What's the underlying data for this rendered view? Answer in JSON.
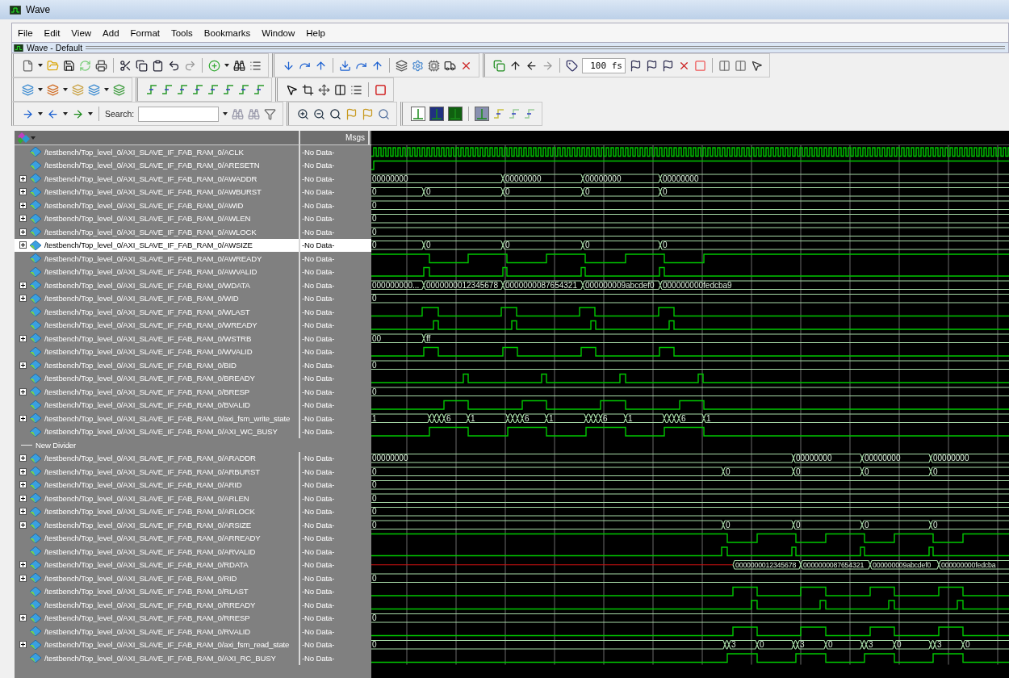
{
  "window": {
    "title": "Wave"
  },
  "menu": [
    "File",
    "Edit",
    "View",
    "Add",
    "Format",
    "Tools",
    "Bookmarks",
    "Window",
    "Help"
  ],
  "subwindow": {
    "title": "Wave - Default"
  },
  "toolbar": {
    "search_label": "Search:",
    "time_step": "100 fs"
  },
  "columns": {
    "messages": "Msgs"
  },
  "signals": [
    {
      "kind": "bit",
      "name": "/testbench/Top_level_0/AXI_SLAVE_IF_FAB_RAM_0/ACLK",
      "msg": "-No Data-",
      "selected": false
    },
    {
      "kind": "bit",
      "name": "/testbench/Top_level_0/AXI_SLAVE_IF_FAB_RAM_0/ARESETN",
      "msg": "-No Data-",
      "selected": false
    },
    {
      "kind": "bus",
      "name": "/testbench/Top_level_0/AXI_SLAVE_IF_FAB_RAM_0/AWADDR",
      "msg": "-No Data-",
      "selected": false,
      "expanded": false,
      "values": [
        "00000000",
        "00000000",
        "00000000",
        "00000000"
      ]
    },
    {
      "kind": "bus",
      "name": "/testbench/Top_level_0/AXI_SLAVE_IF_FAB_RAM_0/AWBURST",
      "msg": "-No Data-",
      "selected": false,
      "expanded": false,
      "values": [
        "0",
        "0",
        "0",
        "0",
        "0"
      ]
    },
    {
      "kind": "bus",
      "name": "/testbench/Top_level_0/AXI_SLAVE_IF_FAB_RAM_0/AWID",
      "msg": "-No Data-",
      "selected": false,
      "expanded": false,
      "values": [
        "0"
      ]
    },
    {
      "kind": "bus",
      "name": "/testbench/Top_level_0/AXI_SLAVE_IF_FAB_RAM_0/AWLEN",
      "msg": "-No Data-",
      "selected": false,
      "expanded": false,
      "values": [
        "0"
      ]
    },
    {
      "kind": "bus",
      "name": "/testbench/Top_level_0/AXI_SLAVE_IF_FAB_RAM_0/AWLOCK",
      "msg": "-No Data-",
      "selected": false,
      "expanded": false,
      "values": [
        "0"
      ]
    },
    {
      "kind": "bus",
      "name": "/testbench/Top_level_0/AXI_SLAVE_IF_FAB_RAM_0/AWSIZE",
      "msg": "-No Data-",
      "selected": true,
      "expanded": false,
      "values": [
        "0",
        "0",
        "0",
        "0",
        "0"
      ]
    },
    {
      "kind": "bit",
      "name": "/testbench/Top_level_0/AXI_SLAVE_IF_FAB_RAM_0/AWREADY",
      "msg": "-No Data-",
      "selected": false
    },
    {
      "kind": "bit",
      "name": "/testbench/Top_level_0/AXI_SLAVE_IF_FAB_RAM_0/AWVALID",
      "msg": "-No Data-",
      "selected": false
    },
    {
      "kind": "bus",
      "name": "/testbench/Top_level_0/AXI_SLAVE_IF_FAB_RAM_0/WDATA",
      "msg": "-No Data-",
      "selected": false,
      "expanded": false,
      "values": [
        "000000000...",
        "0000000012345678",
        "0000000087654321",
        "000000009abcdef0",
        "000000000fedcba9"
      ]
    },
    {
      "kind": "bus",
      "name": "/testbench/Top_level_0/AXI_SLAVE_IF_FAB_RAM_0/WID",
      "msg": "-No Data-",
      "selected": false,
      "expanded": false,
      "values": [
        "0"
      ]
    },
    {
      "kind": "bit",
      "name": "/testbench/Top_level_0/AXI_SLAVE_IF_FAB_RAM_0/WLAST",
      "msg": "-No Data-",
      "selected": false
    },
    {
      "kind": "bit",
      "name": "/testbench/Top_level_0/AXI_SLAVE_IF_FAB_RAM_0/WREADY",
      "msg": "-No Data-",
      "selected": false
    },
    {
      "kind": "bus",
      "name": "/testbench/Top_level_0/AXI_SLAVE_IF_FAB_RAM_0/WSTRB",
      "msg": "-No Data-",
      "selected": false,
      "expanded": false,
      "values": [
        "00",
        "ff"
      ]
    },
    {
      "kind": "bit",
      "name": "/testbench/Top_level_0/AXI_SLAVE_IF_FAB_RAM_0/WVALID",
      "msg": "-No Data-",
      "selected": false
    },
    {
      "kind": "bus",
      "name": "/testbench/Top_level_0/AXI_SLAVE_IF_FAB_RAM_0/BID",
      "msg": "-No Data-",
      "selected": false,
      "expanded": false,
      "values": [
        "0"
      ]
    },
    {
      "kind": "bit",
      "name": "/testbench/Top_level_0/AXI_SLAVE_IF_FAB_RAM_0/BREADY",
      "msg": "-No Data-",
      "selected": false
    },
    {
      "kind": "bus",
      "name": "/testbench/Top_level_0/AXI_SLAVE_IF_FAB_RAM_0/BRESP",
      "msg": "-No Data-",
      "selected": false,
      "expanded": false,
      "values": [
        "0"
      ]
    },
    {
      "kind": "bit",
      "name": "/testbench/Top_level_0/AXI_SLAVE_IF_FAB_RAM_0/BVALID",
      "msg": "-No Data-",
      "selected": false
    },
    {
      "kind": "bus",
      "name": "/testbench/Top_level_0/AXI_SLAVE_IF_FAB_RAM_0/axi_fsm_write_state",
      "msg": "-No Data-",
      "selected": false,
      "expanded": false,
      "values": [
        "1",
        "6",
        "1",
        "6",
        "1",
        "6",
        "1",
        "6",
        "1"
      ]
    },
    {
      "kind": "bit",
      "name": "/testbench/Top_level_0/AXI_SLAVE_IF_FAB_RAM_0/AXI_WC_BUSY",
      "msg": "-No Data-",
      "selected": false
    },
    {
      "kind": "divider",
      "name": "New Divider",
      "selected": false
    },
    {
      "kind": "bus",
      "name": "/testbench/Top_level_0/AXI_SLAVE_IF_FAB_RAM_0/ARADDR",
      "msg": "-No Data-",
      "selected": false,
      "expanded": false,
      "values": [
        "00000000",
        "00000000",
        "00000000",
        "00000000"
      ]
    },
    {
      "kind": "bus",
      "name": "/testbench/Top_level_0/AXI_SLAVE_IF_FAB_RAM_0/ARBURST",
      "msg": "-No Data-",
      "selected": false,
      "expanded": false,
      "values": [
        "0",
        "0",
        "0",
        "0",
        "0"
      ]
    },
    {
      "kind": "bus",
      "name": "/testbench/Top_level_0/AXI_SLAVE_IF_FAB_RAM_0/ARID",
      "msg": "-No Data-",
      "selected": false,
      "expanded": false,
      "values": [
        "0"
      ]
    },
    {
      "kind": "bus",
      "name": "/testbench/Top_level_0/AXI_SLAVE_IF_FAB_RAM_0/ARLEN",
      "msg": "-No Data-",
      "selected": false,
      "expanded": false,
      "values": [
        "0"
      ]
    },
    {
      "kind": "bus",
      "name": "/testbench/Top_level_0/AXI_SLAVE_IF_FAB_RAM_0/ARLOCK",
      "msg": "-No Data-",
      "selected": false,
      "expanded": false,
      "values": [
        "0"
      ]
    },
    {
      "kind": "bus",
      "name": "/testbench/Top_level_0/AXI_SLAVE_IF_FAB_RAM_0/ARSIZE",
      "msg": "-No Data-",
      "selected": false,
      "expanded": false,
      "values": [
        "0",
        "0",
        "0",
        "0",
        "0"
      ]
    },
    {
      "kind": "bit",
      "name": "/testbench/Top_level_0/AXI_SLAVE_IF_FAB_RAM_0/ARREADY",
      "msg": "-No Data-",
      "selected": false
    },
    {
      "kind": "bit",
      "name": "/testbench/Top_level_0/AXI_SLAVE_IF_FAB_RAM_0/ARVALID",
      "msg": "-No Data-",
      "selected": false
    },
    {
      "kind": "bus",
      "name": "/testbench/Top_level_0/AXI_SLAVE_IF_FAB_RAM_0/RDATA",
      "msg": "-No Data-",
      "selected": false,
      "expanded": false,
      "values": [
        "0000000012345678",
        "0000000087654321",
        "000000009abcdef0",
        "000000000fedcba"
      ]
    },
    {
      "kind": "bus",
      "name": "/testbench/Top_level_0/AXI_SLAVE_IF_FAB_RAM_0/RID",
      "msg": "-No Data-",
      "selected": false,
      "expanded": false,
      "values": [
        "0"
      ]
    },
    {
      "kind": "bit",
      "name": "/testbench/Top_level_0/AXI_SLAVE_IF_FAB_RAM_0/RLAST",
      "msg": "-No Data-",
      "selected": false
    },
    {
      "kind": "bit",
      "name": "/testbench/Top_level_0/AXI_SLAVE_IF_FAB_RAM_0/RREADY",
      "msg": "-No Data-",
      "selected": false
    },
    {
      "kind": "bus",
      "name": "/testbench/Top_level_0/AXI_SLAVE_IF_FAB_RAM_0/RRESP",
      "msg": "-No Data-",
      "selected": false,
      "expanded": false,
      "values": [
        "0"
      ]
    },
    {
      "kind": "bit",
      "name": "/testbench/Top_level_0/AXI_SLAVE_IF_FAB_RAM_0/RVALID",
      "msg": "-No Data-",
      "selected": false
    },
    {
      "kind": "bus",
      "name": "/testbench/Top_level_0/AXI_SLAVE_IF_FAB_RAM_0/axi_fsm_read_state",
      "msg": "-No Data-",
      "selected": false,
      "expanded": false,
      "values": [
        "0",
        "3",
        "0",
        "3",
        "0",
        "3",
        "0",
        "3",
        "0"
      ]
    },
    {
      "kind": "bit",
      "name": "/testbench/Top_level_0/AXI_SLAVE_IF_FAB_RAM_0/AXI_RC_BUSY",
      "msg": "-No Data-",
      "selected": false
    }
  ]
}
